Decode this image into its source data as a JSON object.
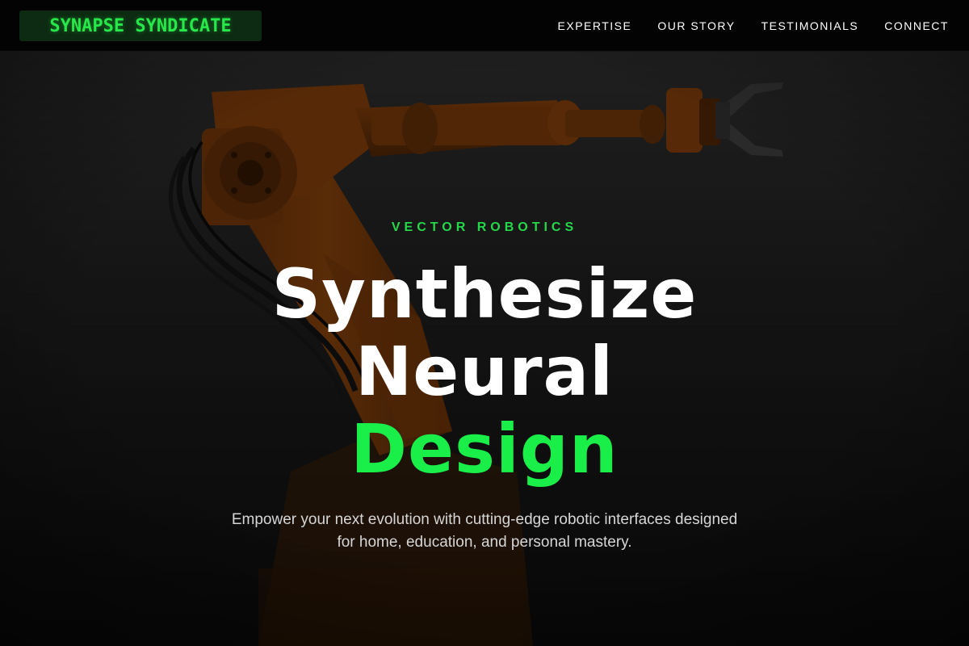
{
  "nav": {
    "logo_text": "SYNAPSE SYNDICATE",
    "links": [
      "EXPERTISE",
      "OUR STORY",
      "TESTIMONIALS",
      "CONNECT"
    ]
  },
  "hero": {
    "eyebrow": "VECTOR ROBOTICS",
    "headline": {
      "line1": "Synthesize",
      "line2": "Neural",
      "line3": "Design"
    },
    "subtitle": "Empower your next evolution with cutting-edge robotic interfaces designed for home, education, and personal mastery."
  },
  "colors": {
    "accent": "#19ee49",
    "logo_bg": "#0d2a12",
    "nav_bg": "#030303",
    "robot_orange": "#d46a12"
  }
}
